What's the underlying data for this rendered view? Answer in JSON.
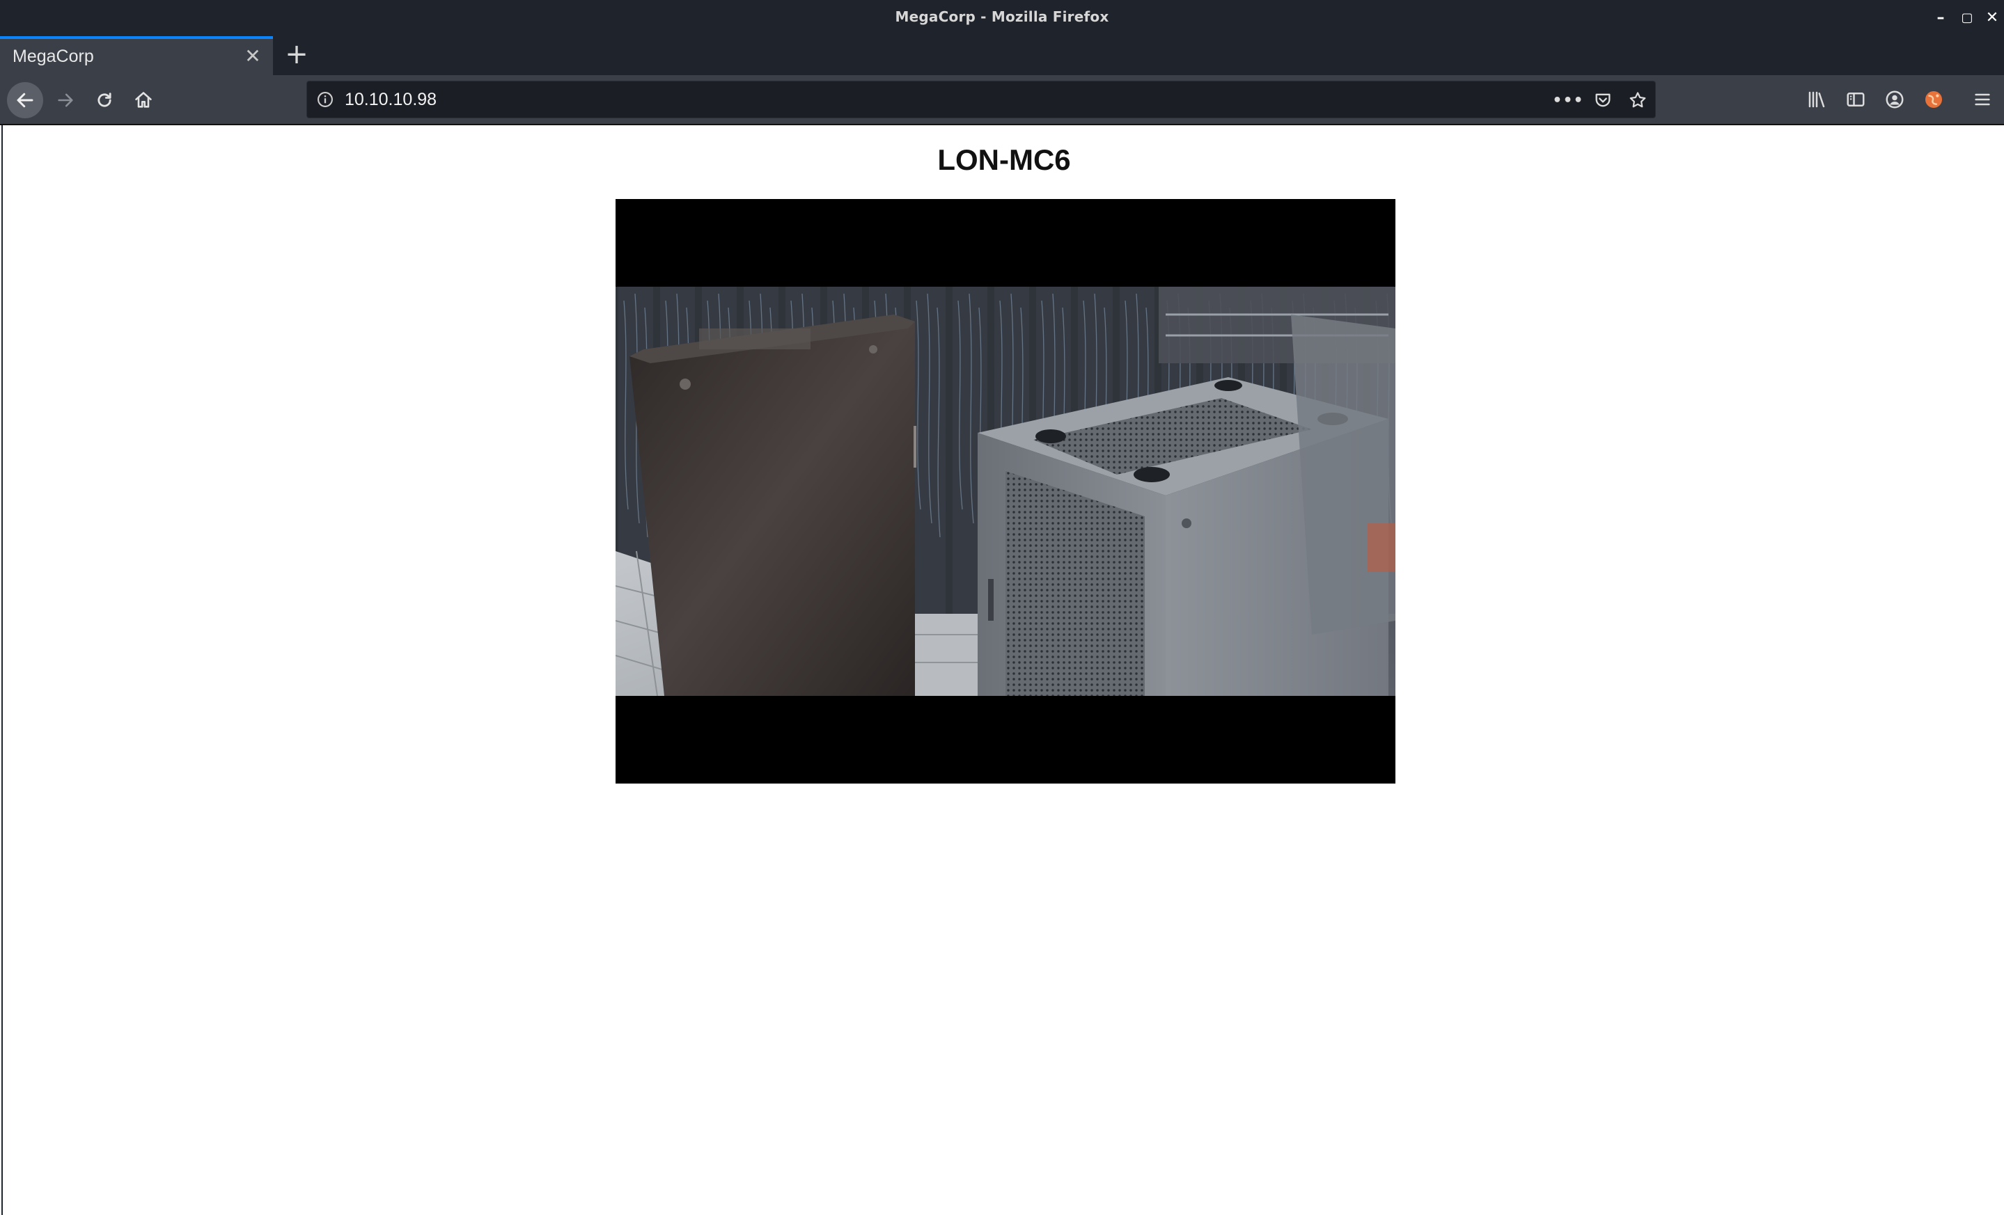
{
  "window": {
    "title": "MegaCorp - Mozilla Firefox",
    "minimize": "–",
    "maximize": "▢",
    "close": "✕"
  },
  "tabs": [
    {
      "label": "MegaCorp",
      "close": "✕"
    }
  ],
  "new_tab": "+",
  "address_bar": {
    "url": "10.10.10.98",
    "more": "•••"
  },
  "page": {
    "heading": "LON-MC6"
  },
  "colors": {
    "chrome_dark": "#1f232b",
    "chrome_mid": "#3a3f48",
    "url_bg": "#1b1e24",
    "tab_accent": "#0a84ff",
    "page_bg": "#ffffff"
  },
  "icons": [
    "back-arrow-icon",
    "forward-arrow-icon",
    "reload-icon",
    "home-icon",
    "info-icon",
    "page-actions-icon",
    "pocket-icon",
    "bookmark-star-icon",
    "library-icon",
    "sidebar-icon",
    "account-icon",
    "extension-icon",
    "menu-icon"
  ]
}
